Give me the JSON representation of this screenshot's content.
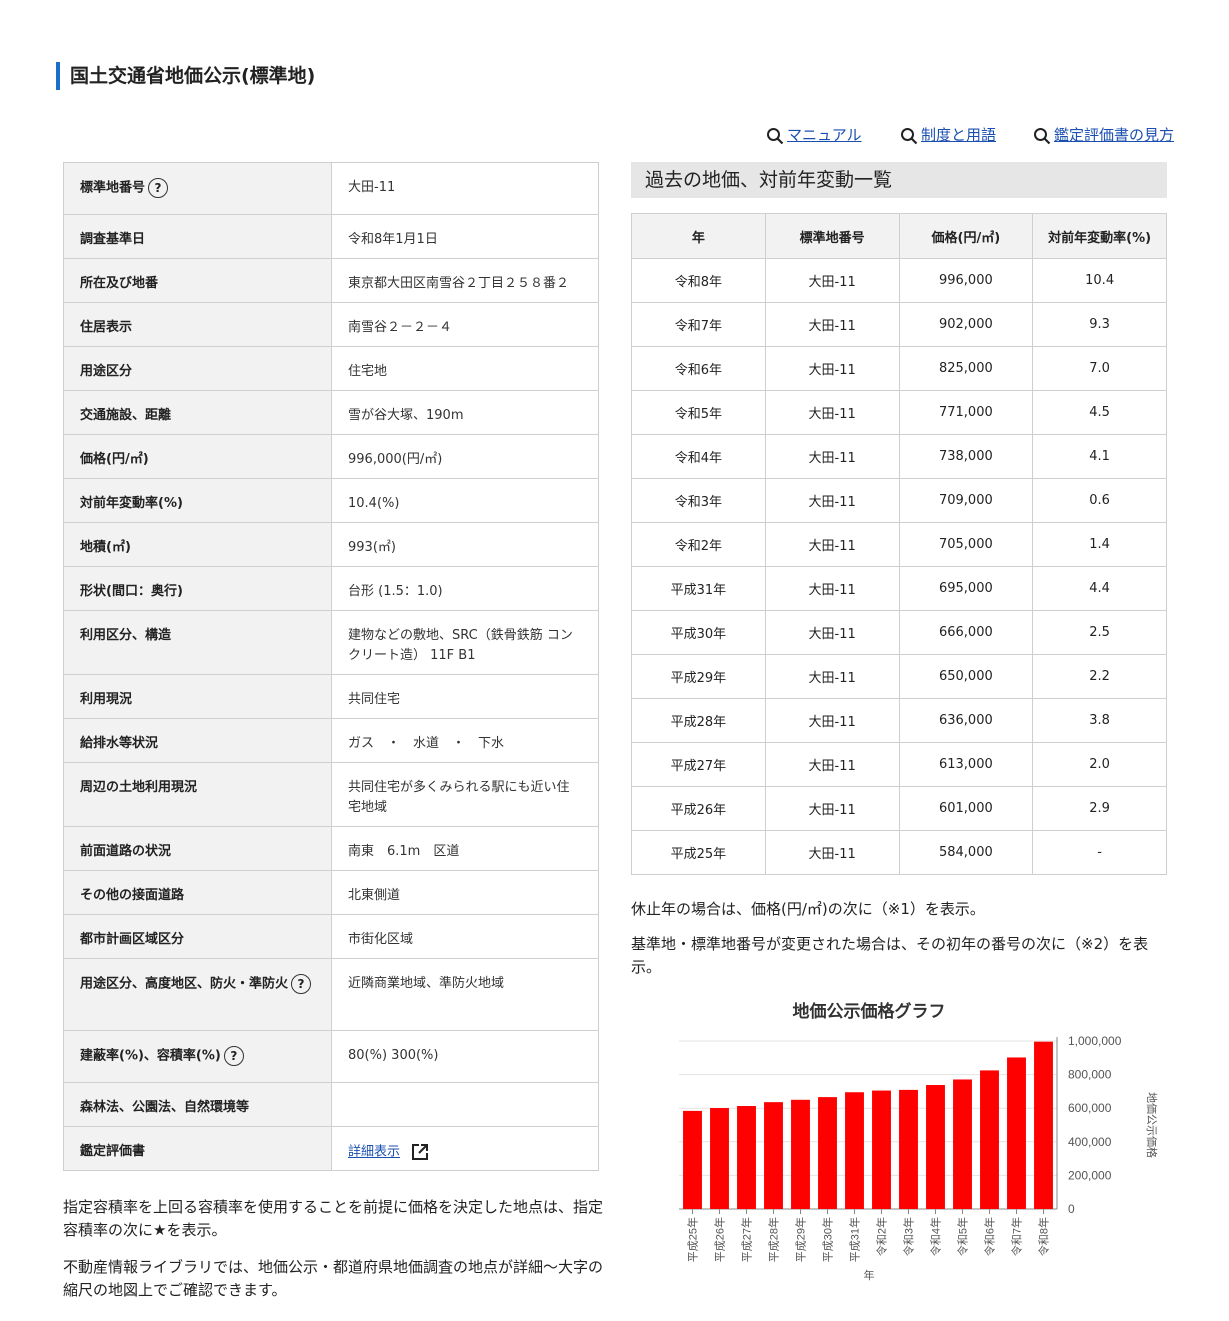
{
  "page": {
    "title": "国土交通省地価公示(標準地)"
  },
  "links": {
    "manual": "マニュアル",
    "terms": "制度と用語",
    "appraisal_guide": "鑑定評価書の見方"
  },
  "detail": {
    "rows": [
      {
        "label": "標準地番号",
        "value": "大田-11",
        "help": true
      },
      {
        "label": "調査基準日",
        "value": "令和8年1月1日"
      },
      {
        "label": "所在及び地番",
        "value": "東京都大田区南雪谷２丁目２５８番２"
      },
      {
        "label": "住居表示",
        "value": "南雪谷２－２－４"
      },
      {
        "label": "用途区分",
        "value": "住宅地"
      },
      {
        "label": "交通施設、距離",
        "value": "雪が谷大塚、190m"
      },
      {
        "label": "価格(円/㎡)",
        "value": "996,000(円/㎡)"
      },
      {
        "label": "対前年変動率(%)",
        "value": "10.4(%)"
      },
      {
        "label": "地積(㎡)",
        "value": "993(㎡)"
      },
      {
        "label": "形状(間口：奥行)",
        "value": "台形 (1.5：1.0)"
      },
      {
        "label": "利用区分、構造",
        "value": "建物などの敷地、SRC（鉄骨鉄筋 コンクリート造） 11F B1"
      },
      {
        "label": "利用現況",
        "value": "共同住宅"
      },
      {
        "label": "給排水等状況",
        "value": "ガス　・　水道　・　下水"
      },
      {
        "label": "周辺の土地利用現況",
        "value": "共同住宅が多くみられる駅にも近い住宅地域"
      },
      {
        "label": "前面道路の状況",
        "value": "南東　6.1m　区道"
      },
      {
        "label": "その他の接面道路",
        "value": "北東側道"
      },
      {
        "label": "都市計画区域区分",
        "value": "市街化区域"
      },
      {
        "label": "用途区分、高度地区、防火・準防火",
        "value": "近隣商業地域、準防火地域",
        "help": true
      },
      {
        "label": "建蔽率(%)、容積率(%)",
        "value": "80(%) 300(%)",
        "help": true
      },
      {
        "label": "森林法、公園法、自然環境等",
        "value": ""
      },
      {
        "label": "鑑定評価書",
        "value": "詳細表示",
        "link": true
      }
    ]
  },
  "notes_left": [
    "指定容積率を上回る容積率を使用することを前提に価格を決定した地点は、指定容積率の次に★を表示。",
    "不動産情報ライブラリでは、地価公示・都道府県地価調査の地点が詳細〜大字の縮尺の地図上でご確認できます。"
  ],
  "history": {
    "heading": "過去の地価、対前年変動一覧",
    "headers": [
      "年",
      "標準地番号",
      "価格(円/㎡)",
      "対前年変動率(%)"
    ],
    "rows": [
      [
        "令和8年",
        "大田-11",
        "996,000",
        "10.4"
      ],
      [
        "令和7年",
        "大田-11",
        "902,000",
        "9.3"
      ],
      [
        "令和6年",
        "大田-11",
        "825,000",
        "7.0"
      ],
      [
        "令和5年",
        "大田-11",
        "771,000",
        "4.5"
      ],
      [
        "令和4年",
        "大田-11",
        "738,000",
        "4.1"
      ],
      [
        "令和3年",
        "大田-11",
        "709,000",
        "0.6"
      ],
      [
        "令和2年",
        "大田-11",
        "705,000",
        "1.4"
      ],
      [
        "平成31年",
        "大田-11",
        "695,000",
        "4.4"
      ],
      [
        "平成30年",
        "大田-11",
        "666,000",
        "2.5"
      ],
      [
        "平成29年",
        "大田-11",
        "650,000",
        "2.2"
      ],
      [
        "平成28年",
        "大田-11",
        "636,000",
        "3.8"
      ],
      [
        "平成27年",
        "大田-11",
        "613,000",
        "2.0"
      ],
      [
        "平成26年",
        "大田-11",
        "601,000",
        "2.9"
      ],
      [
        "平成25年",
        "大田-11",
        "584,000",
        "-"
      ]
    ]
  },
  "notes_right": [
    "休止年の場合は、価格(円/㎡)の次に（※1）を表示。",
    "基準地・標準地番号が変更された場合は、その初年の番号の次に（※2）を表示。"
  ],
  "chart_data": {
    "type": "bar",
    "title": "地価公示価格グラフ",
    "xlabel": "年",
    "ylabel": "地価公示価格",
    "categories": [
      "平成25年",
      "平成26年",
      "平成27年",
      "平成28年",
      "平成29年",
      "平成30年",
      "平成31年",
      "令和2年",
      "令和3年",
      "令和4年",
      "令和5年",
      "令和6年",
      "令和7年",
      "令和8年"
    ],
    "values": [
      584000,
      601000,
      613000,
      636000,
      650000,
      666000,
      695000,
      705000,
      709000,
      738000,
      771000,
      825000,
      902000,
      996000
    ],
    "ylim": [
      0,
      1000000
    ],
    "yticks": [
      "0",
      "200,000",
      "400,000",
      "600,000",
      "800,000",
      "1,000,000"
    ],
    "ytick_values": [
      0,
      200000,
      400000,
      600000,
      800000,
      1000000
    ],
    "bar_color": "#ff0000",
    "grid": true
  }
}
